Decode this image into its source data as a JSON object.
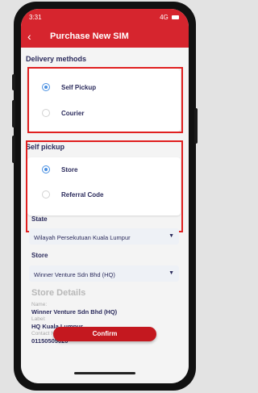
{
  "status_bar": {
    "time": "3:31",
    "signal": "4G"
  },
  "header": {
    "back_icon": "chevron-left-icon",
    "title": "Purchase New SIM"
  },
  "delivery": {
    "title": "Delivery methods",
    "options": [
      {
        "label": "Self Pickup",
        "selected": true
      },
      {
        "label": "Courier",
        "selected": false
      }
    ]
  },
  "self_pickup": {
    "title": "Self pickup",
    "options": [
      {
        "label": "Store",
        "selected": true
      },
      {
        "label": "Referral Code",
        "selected": false
      }
    ]
  },
  "form": {
    "state_label": "State",
    "state_value": "Wilayah Persekutuan Kuala Lumpur",
    "store_label": "Store",
    "store_value": "Winner Venture Sdn Bhd (HQ)"
  },
  "store_details": {
    "title": "Store Details",
    "name_label": "Name:",
    "name_value": "Winner Venture Sdn Bhd (HQ)",
    "label_label": "Label:",
    "label_value": "HQ Kuala Lumpur",
    "contact_label": "Contact Number:",
    "contact_value": "01150505020"
  },
  "confirm_label": "Confirm",
  "colors": {
    "primary": "#d6252e",
    "accent": "#4a90e2",
    "highlight": "#e02020"
  }
}
